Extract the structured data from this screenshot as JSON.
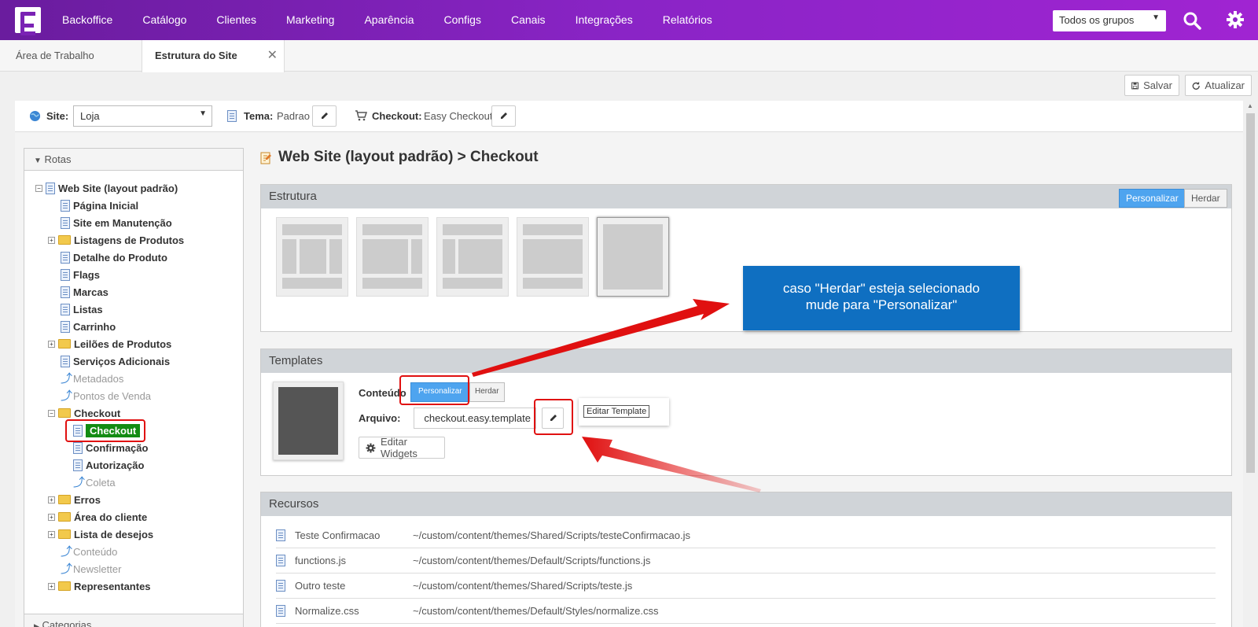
{
  "topnav": {
    "items": [
      "Backoffice",
      "Catálogo",
      "Clientes",
      "Marketing",
      "Aparência",
      "Configs",
      "Canais",
      "Integrações",
      "Relatórios"
    ],
    "group_select": "Todos os grupos"
  },
  "tabs": [
    {
      "label": "Área de Trabalho"
    },
    {
      "label": "Estrutura do Site"
    }
  ],
  "toolbar": {
    "save": "Salvar",
    "refresh": "Atualizar"
  },
  "sitebar": {
    "site_label": "Site:",
    "site_value": "Loja",
    "tema_label": "Tema:",
    "tema_value": "Padrao",
    "checkout_label": "Checkout:",
    "checkout_value": "Easy Checkout"
  },
  "tree": {
    "header": "Rotas",
    "footer": "Categorias",
    "root": "Web Site (layout padrão)",
    "nodes": [
      {
        "label": "Página Inicial"
      },
      {
        "label": "Site em Manutenção"
      },
      {
        "label": "Listagens de Produtos"
      },
      {
        "label": "Detalhe do Produto"
      },
      {
        "label": "Flags"
      },
      {
        "label": "Marcas"
      },
      {
        "label": "Listas"
      },
      {
        "label": "Carrinho"
      },
      {
        "label": "Leilões de Produtos"
      },
      {
        "label": "Serviços Adicionais"
      },
      {
        "label": "Metadados"
      },
      {
        "label": "Pontos de Venda"
      },
      {
        "label": "Checkout"
      },
      {
        "label": "Checkout"
      },
      {
        "label": "Confirmação"
      },
      {
        "label": "Autorização"
      },
      {
        "label": "Coleta"
      },
      {
        "label": "Erros"
      },
      {
        "label": "Área do cliente"
      },
      {
        "label": "Lista de desejos"
      },
      {
        "label": "Conteúdo"
      },
      {
        "label": "Newsletter"
      },
      {
        "label": "Representantes"
      }
    ]
  },
  "main": {
    "title": "Web Site (layout padrão)  > Checkout",
    "estrutura": {
      "title": "Estrutura",
      "personalizar": "Personalizar",
      "herdar": "Herdar"
    },
    "callout": [
      "caso \"Herdar\" esteja selecionado",
      "mude para \"Personalizar\""
    ],
    "templates": {
      "title": "Templates",
      "conteudo_label": "Conteúdo",
      "personalizar": "Personalizar",
      "herdar": "Herdar",
      "arquivo_label": "Arquivo:",
      "arquivo_value": "checkout.easy.template",
      "tooltip": "Editar Template",
      "editar_widgets": "Editar Widgets"
    },
    "recursos": {
      "title": "Recursos",
      "rows": [
        {
          "name": "Teste Confirmacao",
          "path": "~/custom/content/themes/Shared/Scripts/testeConfirmacao.js"
        },
        {
          "name": "functions.js",
          "path": "~/custom/content/themes/Default/Scripts/functions.js"
        },
        {
          "name": "Outro teste",
          "path": "~/custom/content/themes/Shared/Scripts/teste.js"
        },
        {
          "name": "Normalize.css",
          "path": "~/custom/content/themes/Default/Styles/normalize.css"
        }
      ]
    }
  },
  "colors": {
    "nav_start": "#6a1c9e",
    "nav_end": "#a024d2",
    "accent": "#4ea4ef",
    "callout": "#0f6fc1",
    "annotation": "#e01010",
    "selected": "#138c13"
  }
}
